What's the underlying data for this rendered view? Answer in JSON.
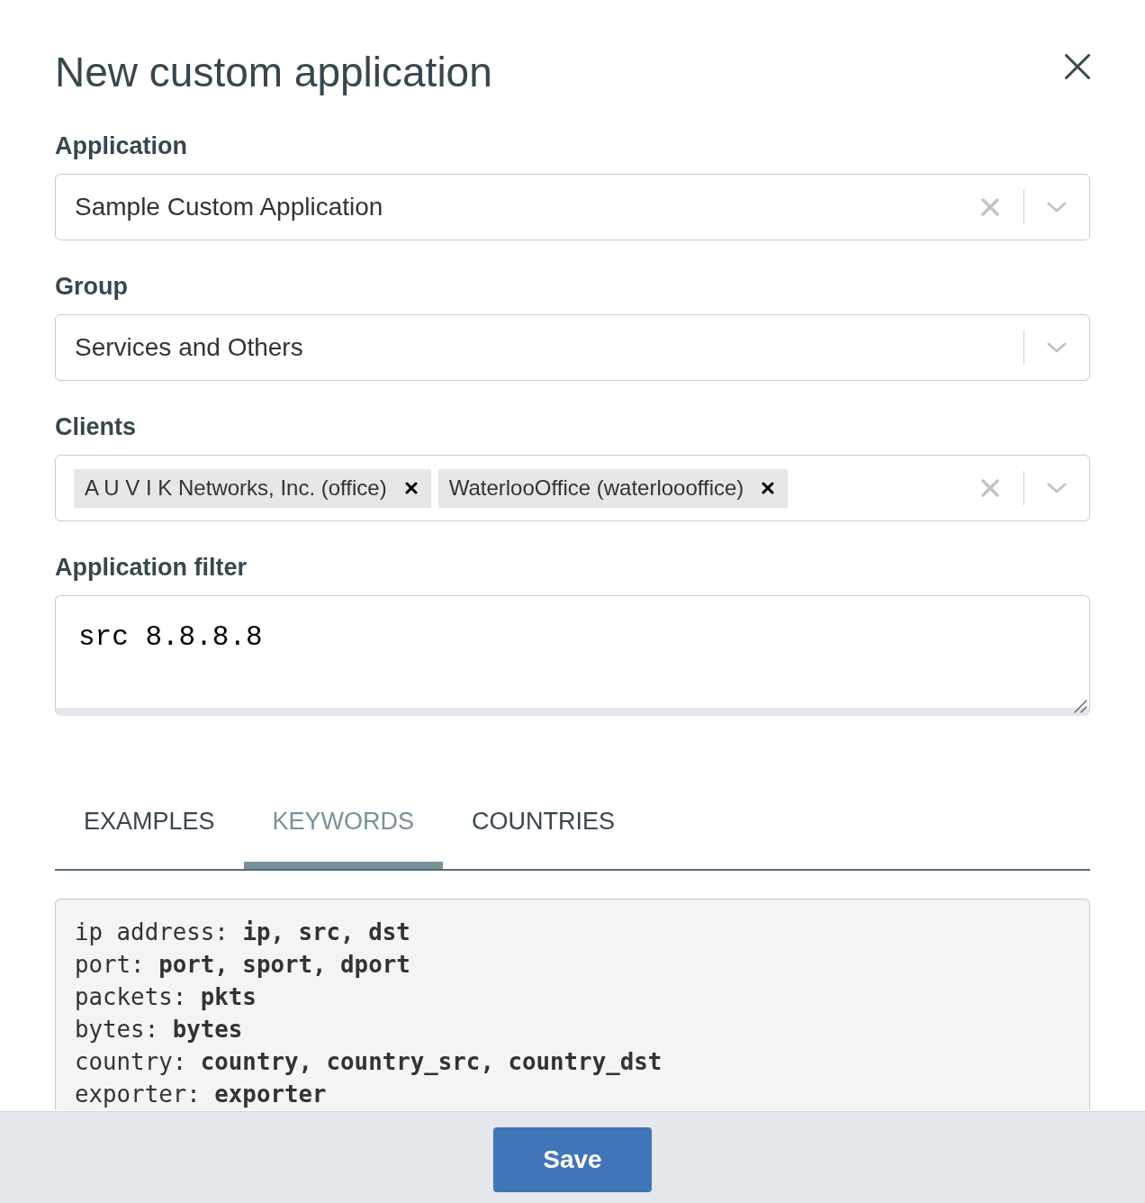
{
  "dialog": {
    "title": "New custom application"
  },
  "fields": [
    {
      "kind": "select",
      "label": "Application",
      "value": "Sample Custom Application",
      "clearable": true
    },
    {
      "kind": "select",
      "label": "Group",
      "value": "Services and Others",
      "clearable": false
    },
    {
      "kind": "multiselect",
      "label": "Clients",
      "tags": [
        "A U V I K Networks, Inc. (office)",
        "WaterlooOffice (waterloooffice)"
      ],
      "clearable": true
    },
    {
      "kind": "textarea",
      "label": "Application filter",
      "value": "src 8.8.8.8"
    }
  ],
  "tabs": [
    {
      "label": "EXAMPLES",
      "selected": false
    },
    {
      "label": "KEYWORDS",
      "selected": true
    },
    {
      "label": "COUNTRIES",
      "selected": false
    }
  ],
  "keywords": [
    "ip address: **ip, src, dst**",
    "port: **port, sport, dport**",
    "packets: **pkts**",
    "bytes: **bytes**",
    "country: **country, country_src, country_dst**",
    "exporter: **exporter**"
  ],
  "footer": {
    "buttons": [
      "Save"
    ]
  }
}
